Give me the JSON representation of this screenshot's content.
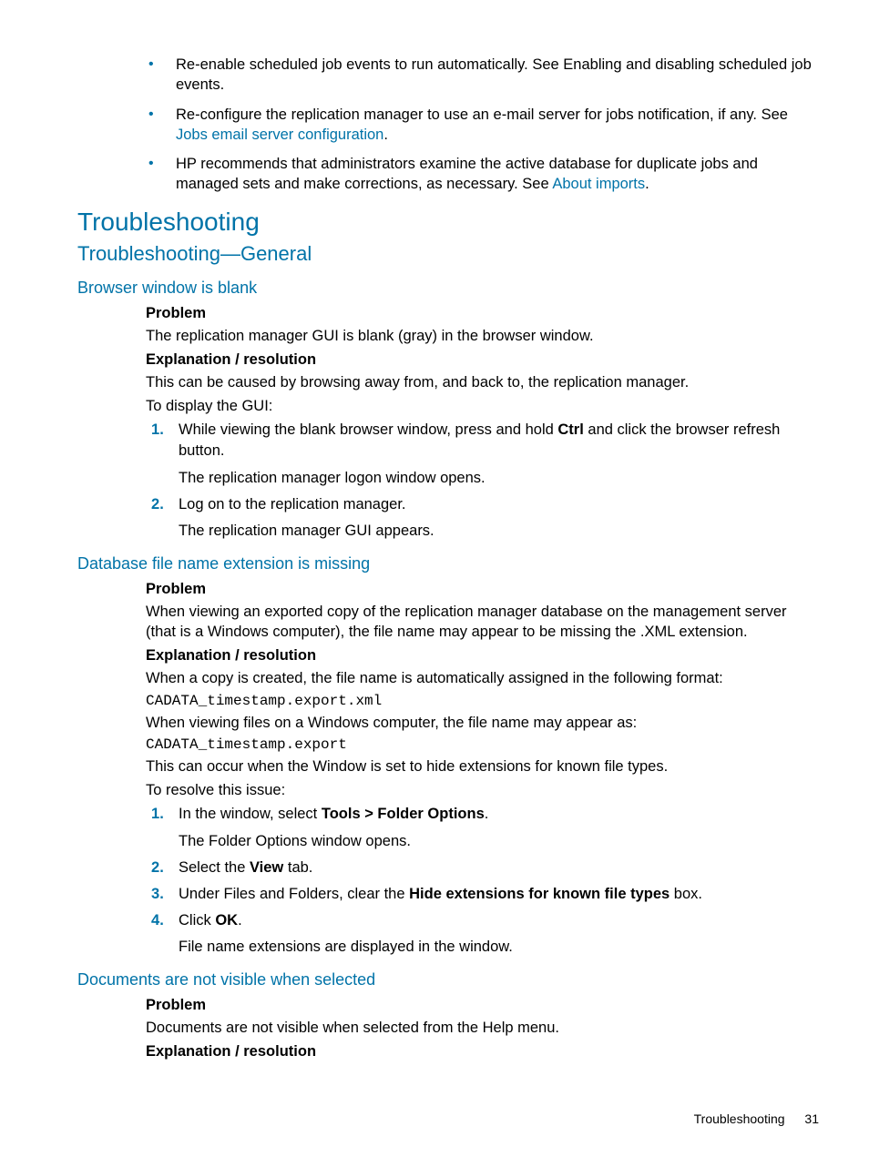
{
  "intro_bullets": {
    "b1": "Re-enable scheduled job events to run automatically. See Enabling and disabling scheduled job events.",
    "b2_pre": "Re-configure the replication manager to use an e-mail server for jobs notification, if any. See ",
    "b2_link": "Jobs email server configuration",
    "b2_post": ".",
    "b3_pre": "HP recommends that administrators examine the active database for duplicate jobs and managed sets and make corrections, as necessary. See ",
    "b3_link": "About imports",
    "b3_post": "."
  },
  "h1": "Troubleshooting",
  "h2": "Troubleshooting—General",
  "labels": {
    "problem": "Problem",
    "explanation": "Explanation / resolution"
  },
  "topic1": {
    "title": "Browser window is blank",
    "problem": "The replication manager GUI is blank (gray) in the browser window.",
    "exp1": "This can be caused by browsing away from, and back to, the replication manager.",
    "exp2": "To display the GUI:",
    "step1_pre": "While viewing the blank browser window, press and hold ",
    "step1_b": "Ctrl",
    "step1_post": " and click the browser refresh button.",
    "step1_sub": "The replication manager logon window opens.",
    "step2": "Log on to the replication manager.",
    "step2_sub": "The replication manager GUI appears."
  },
  "topic2": {
    "title": "Database file name extension is missing",
    "problem": "When viewing an exported copy of the replication manager database on the management server (that is a Windows computer), the file name may appear to be missing the .XML extension.",
    "exp1": "When a copy is created, the file name is automatically assigned in the following format:",
    "code1": "CADATA_timestamp.export.xml",
    "exp2": "When viewing files on a Windows computer, the file name may appear as:",
    "code2": "CADATA_timestamp.export",
    "exp3": "This can occur when the Window is set to hide extensions for known file types.",
    "exp4": "To resolve this issue:",
    "s1_pre": "In the window, select ",
    "s1_b": "Tools > Folder Options",
    "s1_post": ".",
    "s1_sub": "The Folder Options window opens.",
    "s2_pre": "Select the ",
    "s2_b": "View",
    "s2_post": " tab.",
    "s3_pre": "Under Files and Folders, clear the ",
    "s3_b": "Hide extensions for known file types",
    "s3_post": " box.",
    "s4_pre": "Click ",
    "s4_b": "OK",
    "s4_post": ".",
    "s4_sub": "File name extensions are displayed in the window."
  },
  "topic3": {
    "title": "Documents are not visible when selected",
    "problem": "Documents are not visible when selected from the Help menu."
  },
  "footer": {
    "section": "Troubleshooting",
    "page": "31"
  }
}
